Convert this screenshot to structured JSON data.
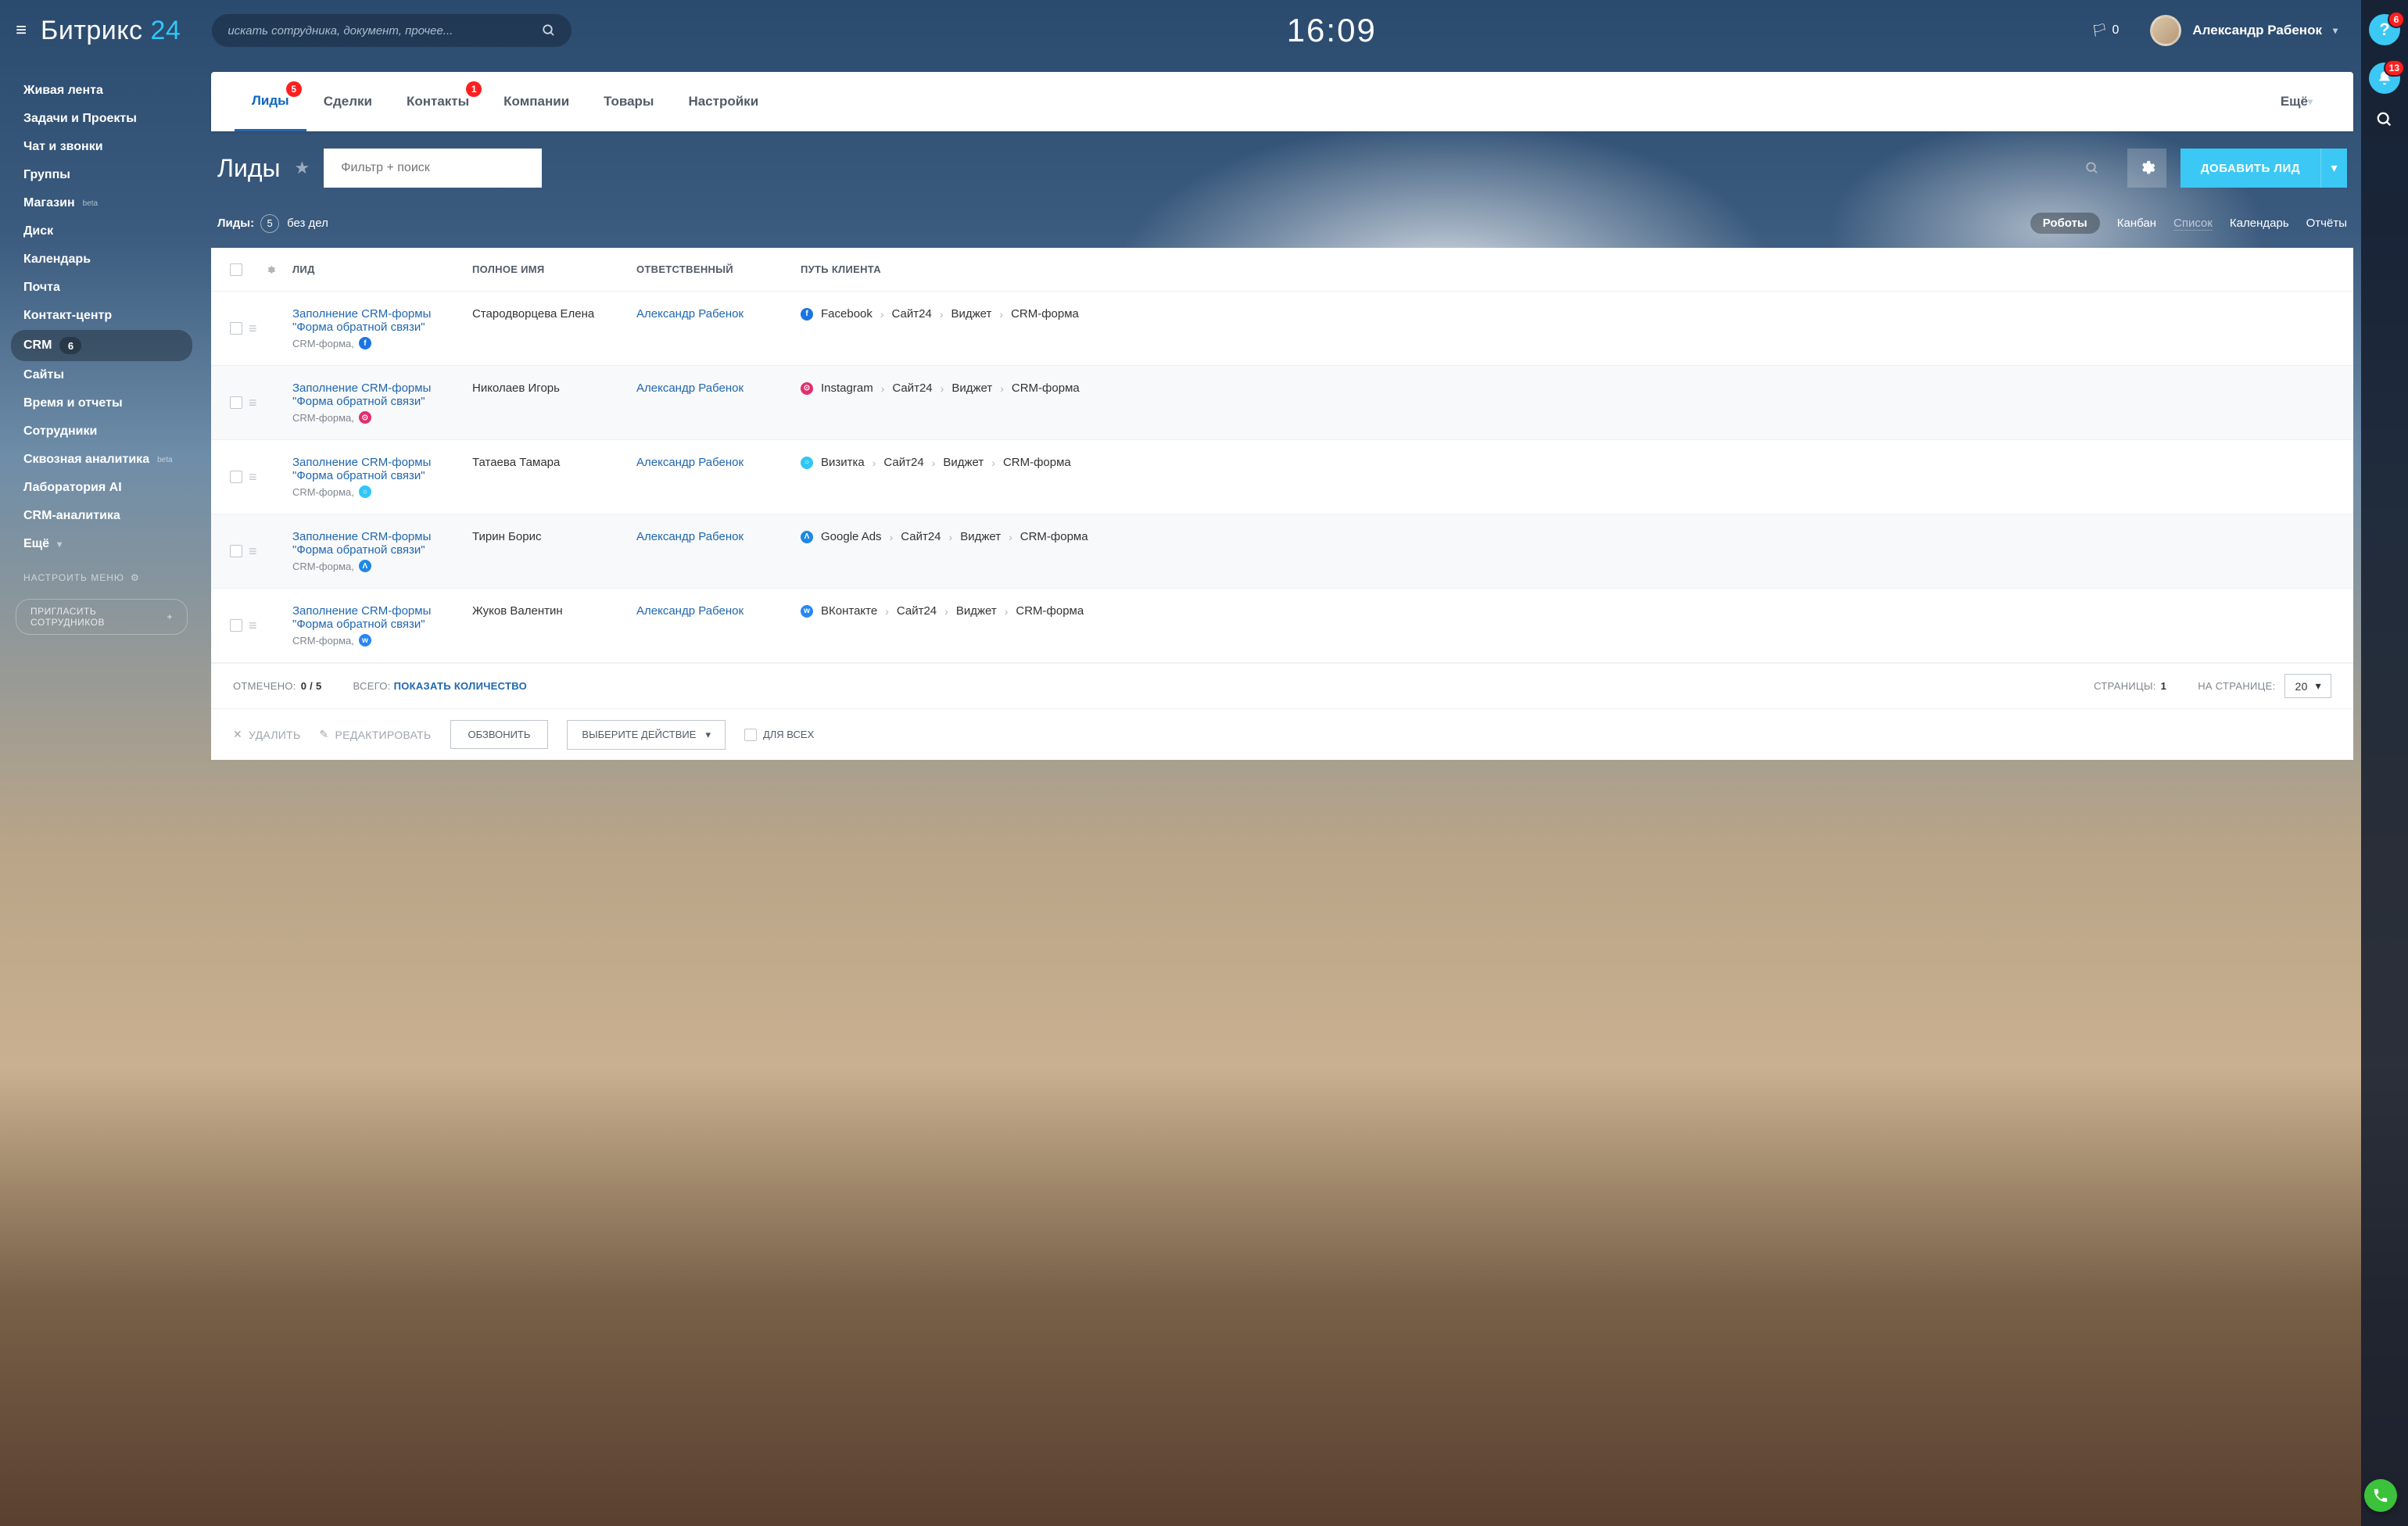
{
  "logo": {
    "part1": "Битрикс",
    "part2": "24"
  },
  "top_search_placeholder": "искать сотрудника, документ, прочее...",
  "clock": "16:09",
  "flag_count": "0",
  "user_name": "Александр Рабенок",
  "rail": {
    "help_badge": "6",
    "bell_badge": "13"
  },
  "leftnav": {
    "items": [
      {
        "label": "Живая лента"
      },
      {
        "label": "Задачи и Проекты"
      },
      {
        "label": "Чат и звонки"
      },
      {
        "label": "Группы"
      },
      {
        "label": "Магазин",
        "sup": "beta"
      },
      {
        "label": "Диск"
      },
      {
        "label": "Календарь"
      },
      {
        "label": "Почта"
      },
      {
        "label": "Контакт-центр"
      },
      {
        "label": "CRM",
        "badge": "6",
        "active": true
      },
      {
        "label": "Сайты"
      },
      {
        "label": "Время и отчеты"
      },
      {
        "label": "Сотрудники"
      },
      {
        "label": "Сквозная аналитика",
        "sup": "beta"
      },
      {
        "label": "Лаборатория AI"
      },
      {
        "label": "CRM-аналитика"
      },
      {
        "label": "Ещё",
        "chevron": true
      }
    ],
    "config": "Настроить меню",
    "invite": "Пригласить сотрудников"
  },
  "tabs": [
    {
      "label": "Лиды",
      "badge": "5",
      "active": true
    },
    {
      "label": "Сделки"
    },
    {
      "label": "Контакты",
      "badge": "1"
    },
    {
      "label": "Компании"
    },
    {
      "label": "Товары"
    },
    {
      "label": "Настройки"
    }
  ],
  "tabs_more": "Ещё",
  "page_title": "Лиды",
  "filter_placeholder": "Фильтр + поиск",
  "add_button": "ДОБАВИТЬ ЛИД",
  "subbar": {
    "label": "Лиды:",
    "count": "5",
    "filter": "без дел",
    "robots": "Роботы",
    "views": [
      {
        "label": "Канбан"
      },
      {
        "label": "Список",
        "active": true
      },
      {
        "label": "Календарь"
      },
      {
        "label": "Отчёты"
      }
    ]
  },
  "columns": {
    "lead": "Лид",
    "name": "Полное имя",
    "resp": "Ответственный",
    "path": "Путь клиента"
  },
  "rows": [
    {
      "lead": "Заполнение CRM-формы \"Форма обратной связи\"",
      "sub": "CRM-форма,",
      "src": "fb",
      "src_label": "f",
      "name": "Стародворцева Елена",
      "resp": "Александр Рабенок",
      "path": [
        {
          "icon": "fb",
          "label": "Facebook"
        },
        {
          "label": "Сайт24"
        },
        {
          "label": "Виджет"
        },
        {
          "label": "CRM-форма"
        }
      ]
    },
    {
      "lead": "Заполнение CRM-формы \"Форма обратной связи\"",
      "sub": "CRM-форма,",
      "src": "ig",
      "src_label": "⊙",
      "name": "Николаев Игорь",
      "resp": "Александр Рабенок",
      "path": [
        {
          "icon": "ig",
          "label": "Instagram"
        },
        {
          "label": "Сайт24"
        },
        {
          "label": "Виджет"
        },
        {
          "label": "CRM-форма"
        }
      ]
    },
    {
      "lead": "Заполнение CRM-формы \"Форма обратной связи\"",
      "sub": "CRM-форма,",
      "src": "card",
      "src_label": "○",
      "name": "Татаева Тамара",
      "resp": "Александр Рабенок",
      "path": [
        {
          "icon": "card",
          "label": "Визитка"
        },
        {
          "label": "Сайт24"
        },
        {
          "label": "Виджет"
        },
        {
          "label": "CRM-форма"
        }
      ]
    },
    {
      "lead": "Заполнение CRM-формы \"Форма обратной связи\"",
      "sub": "CRM-форма,",
      "src": "ga",
      "src_label": "Λ",
      "name": "Тирин Борис",
      "resp": "Александр Рабенок",
      "path": [
        {
          "icon": "ga",
          "label": "Google Ads"
        },
        {
          "label": "Сайт24"
        },
        {
          "label": "Виджет"
        },
        {
          "label": "CRM-форма"
        }
      ]
    },
    {
      "lead": "Заполнение CRM-формы \"Форма обратной связи\"",
      "sub": "CRM-форма,",
      "src": "vk",
      "src_label": "w",
      "name": "Жуков Валентин",
      "resp": "Александр Рабенок",
      "path": [
        {
          "icon": "vk",
          "label": "ВКонтакте"
        },
        {
          "label": "Сайт24"
        },
        {
          "label": "Виджет"
        },
        {
          "label": "CRM-форма"
        }
      ]
    }
  ],
  "footer": {
    "selected_label": "Отмечено:",
    "selected_val": "0 / 5",
    "total_label": "Всего:",
    "total_link": "Показать количество",
    "pages_label": "Страницы:",
    "pages_val": "1",
    "perpage_label": "На странице:",
    "perpage_val": "20"
  },
  "actions": {
    "delete": "Удалить",
    "edit": "Редактировать",
    "call": "Обзвонить",
    "select": "Выберите действие",
    "forall": "Для всех"
  }
}
